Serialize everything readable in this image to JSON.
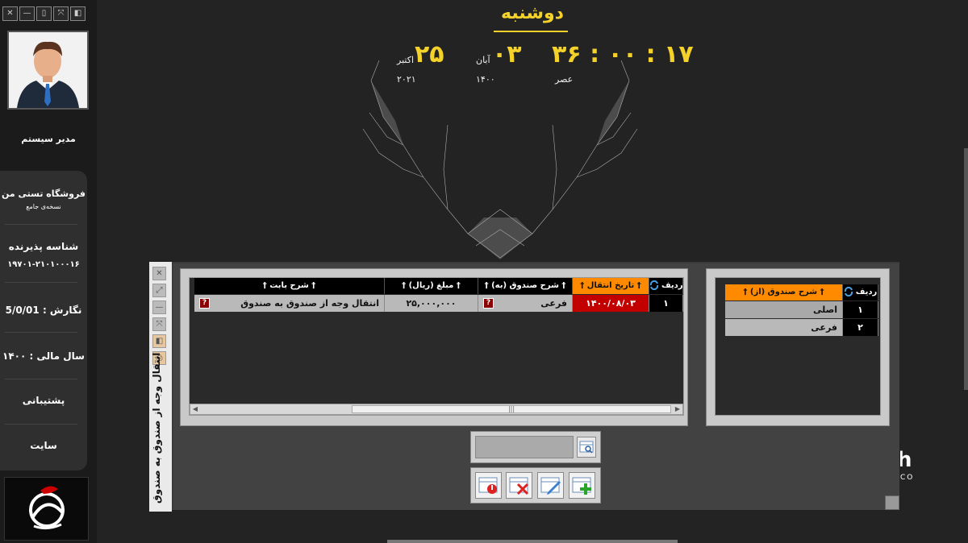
{
  "window_buttons": [
    "✕",
    "—",
    "▯",
    "⤧",
    "◧"
  ],
  "user": {
    "name": "مدیر سیستم"
  },
  "store": {
    "name": "فروشگاه تستی من",
    "subtitle": "نسخه‌ی جامع"
  },
  "acceptor": {
    "label": "شناسه پذیرنده",
    "value": "۱۹۷۰۱-۲۱۰۱۰۰۰۱۶"
  },
  "version": {
    "label": "نگارش : 5/0/01"
  },
  "fiscal_year": {
    "label": "سال مالی : ۱۴۰۰"
  },
  "support": {
    "label": "پشتیبانی"
  },
  "site": {
    "label": "سایت"
  },
  "clock": {
    "day_name": "دوشنبه",
    "time": "۳۶ : ۰۰ : ۱۷",
    "period": "عصر",
    "persian_day": "۰۳",
    "persian_month": "آبان",
    "persian_year": "۱۴۰۰",
    "greg_day": "۲۵",
    "greg_month": "اکتبر",
    "greg_year": "۲۰۲۱"
  },
  "dialog": {
    "title": "انتقال وجه از صندوق به صندوق",
    "side_icons": [
      "✕",
      "⤢",
      "—",
      "⤧",
      "◧",
      "⎙"
    ]
  },
  "source_grid": {
    "headers": [
      "ردیف",
      "† شرح صندوق (از) †"
    ],
    "rows": [
      {
        "num": "۱",
        "desc": "اصلی"
      },
      {
        "num": "۲",
        "desc": "فرعی"
      }
    ]
  },
  "transfer_grid": {
    "headers": {
      "row": "ردیف",
      "date": "† تاریخ انتقال †",
      "to_box": "† شرح صندوق (به) †",
      "amount": "† مبلغ (ریال) †",
      "reason": "† شرح بابت †"
    },
    "rows": [
      {
        "num": "۱",
        "date": "۱۴۰۰/۰۸/۰۳",
        "to_box": "فرعی",
        "amount": "۲۵,۰۰۰,۰۰۰",
        "reason": "انتقال وجه از صندوق به صندوق"
      }
    ]
  },
  "scrollbar_grip": "|||",
  "background_text": {
    "brand_letter": "h",
    "brand_sub": "CO"
  },
  "colors": {
    "accent": "#f5d22a",
    "header_active": "#ff8a00",
    "date_cell": "#c30000"
  },
  "icons": [
    "refresh-icon",
    "question-icon",
    "search-icon",
    "cancel-icon",
    "delete-icon",
    "edit-icon",
    "add-icon"
  ]
}
